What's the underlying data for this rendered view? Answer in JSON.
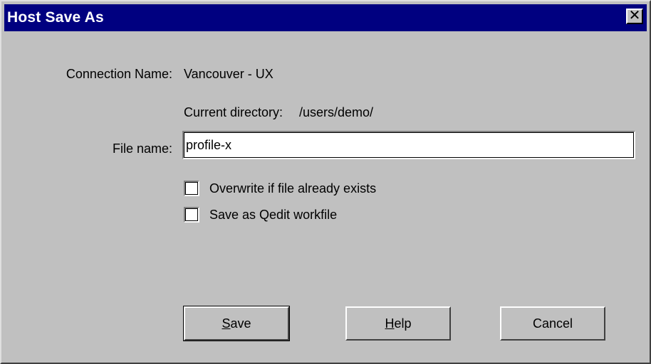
{
  "dialog": {
    "title": "Host Save As",
    "close_symbol": "✕"
  },
  "connection": {
    "label": "Connection Name:",
    "value": "Vancouver - UX"
  },
  "directory": {
    "label": "Current directory:",
    "value": "/users/demo/"
  },
  "file": {
    "label": "File name:",
    "value": "profile-x"
  },
  "options": {
    "overwrite": {
      "label": "Overwrite if file already exists",
      "checked": false
    },
    "qedit": {
      "label": "Save as Qedit workfile",
      "checked": false
    }
  },
  "buttons": {
    "save": {
      "mnemonic": "S",
      "rest": "ave"
    },
    "help": {
      "mnemonic": "H",
      "rest": "elp"
    },
    "cancel": {
      "label": "Cancel"
    }
  },
  "colors": {
    "titlebar": "#000080",
    "face": "#c0c0c0"
  }
}
